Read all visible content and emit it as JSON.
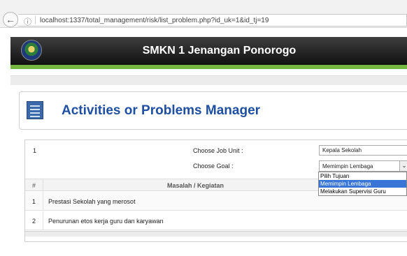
{
  "browser": {
    "url": "localhost:1337/total_management/risk/list_problem.php?id_uk=1&id_tj=19"
  },
  "header": {
    "title": "SMKN 1 Jenangan Ponorogo"
  },
  "page": {
    "title": "Activities or Problems Manager"
  },
  "form": {
    "row_number": "1",
    "job_unit_label": "Choose Job Unit :",
    "job_unit_value": "Kepala Sekolah",
    "goal_label": "Choose Goal :",
    "goal_value": "Memimpin Lembaga",
    "goal_options": [
      "Pilih Tujuan",
      "Memimpin Lembaga",
      "Melakukan Supervisi Guru"
    ]
  },
  "table": {
    "headers": [
      "#",
      "Masalah / Kegiatan"
    ],
    "rows": [
      {
        "num": "1",
        "text": "Prestasi Sekolah yang merosot"
      },
      {
        "num": "2",
        "text": "Penurunan etos kerja guru dan karyawan"
      }
    ]
  },
  "colors": {
    "header_bg": "#1a1a1a",
    "accent_green": "#74b83f",
    "title_blue": "#1f4fa0",
    "selected_option": "#3875d7"
  }
}
